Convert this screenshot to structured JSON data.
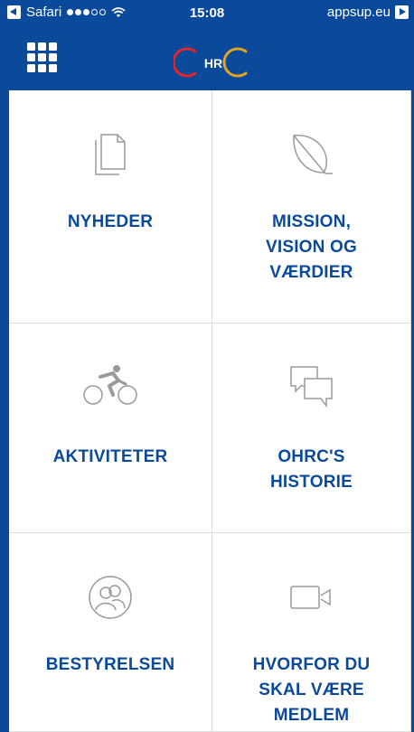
{
  "status_bar": {
    "back_app": "Safari",
    "time": "15:08",
    "domain": "appsup.eu"
  },
  "header": {
    "menu_icon": "grid-menu-icon",
    "logo_text": "HR",
    "colors": {
      "bar": "#0b4a9a",
      "logo_red": "#e3262b",
      "logo_gold": "#e0a526"
    }
  },
  "tiles": [
    {
      "label": "NYHEDER",
      "icon": "documents-icon"
    },
    {
      "label": "MISSION,\nVISION OG\nVÆRDIER",
      "icon": "leaf-icon"
    },
    {
      "label": "AKTIVITETER",
      "icon": "cyclist-icon"
    },
    {
      "label": "OHRC'S\nHISTORIE",
      "icon": "speech-bubbles-icon"
    },
    {
      "label": "BESTYRELSEN",
      "icon": "people-icon"
    },
    {
      "label": "HVORFOR DU\nSKAL VÆRE\nMEDLEM",
      "icon": "video-camera-icon"
    }
  ]
}
